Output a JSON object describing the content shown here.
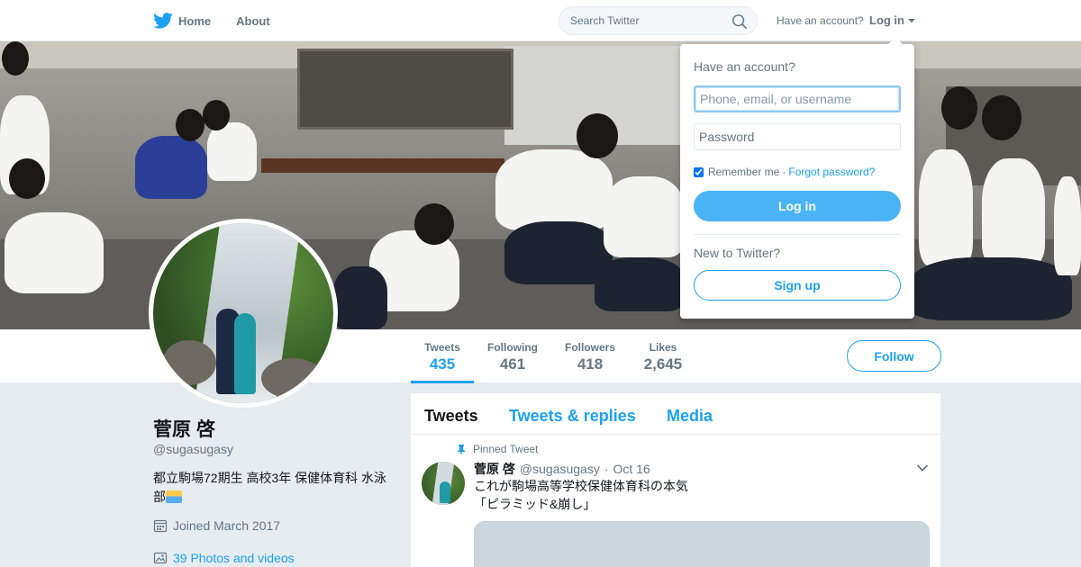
{
  "nav": {
    "home_label": "Home",
    "about_label": "About",
    "search_placeholder": "Search Twitter",
    "have_account": "Have an account?",
    "login_label": "Log in"
  },
  "colors": {
    "brand": "#1da1f2",
    "login_button": "#4ab3f4",
    "background": "#e6ecf0"
  },
  "profile": {
    "name": "菅原 啓",
    "handle": "@sugasugasy",
    "bio": "都立駒場72期生 高校3年 保健体育科 水泳部",
    "joined": "Joined March 2017",
    "photos": "39 Photos and videos"
  },
  "stats": [
    {
      "label": "Tweets",
      "value": "435",
      "active": true
    },
    {
      "label": "Following",
      "value": "461",
      "active": false
    },
    {
      "label": "Followers",
      "value": "418",
      "active": false
    },
    {
      "label": "Likes",
      "value": "2,645",
      "active": false
    }
  ],
  "follow_label": "Follow",
  "timeline": {
    "tabs": [
      "Tweets",
      "Tweets & replies",
      "Media"
    ],
    "pinned_label": "Pinned Tweet",
    "tweet": {
      "name": "菅原 啓",
      "handle": "@sugasugasy",
      "date": "Oct 16",
      "line1": "これが駒場高等学校保健体育科の本気",
      "line2": "「ピラミッド&崩し」"
    }
  },
  "login_dropdown": {
    "title": "Have an account?",
    "username_placeholder": "Phone, email, or username",
    "password_placeholder": "Password",
    "remember_label": "Remember me",
    "separator": "·",
    "forgot_label": "Forgot password?",
    "login_button": "Log in",
    "new_label": "New to Twitter?",
    "signup_button": "Sign up"
  },
  "icons": [
    "twitter-bird-icon",
    "search-icon",
    "caret-down-icon",
    "calendar-icon",
    "photo-icon",
    "pin-icon",
    "chevron-down-icon"
  ]
}
